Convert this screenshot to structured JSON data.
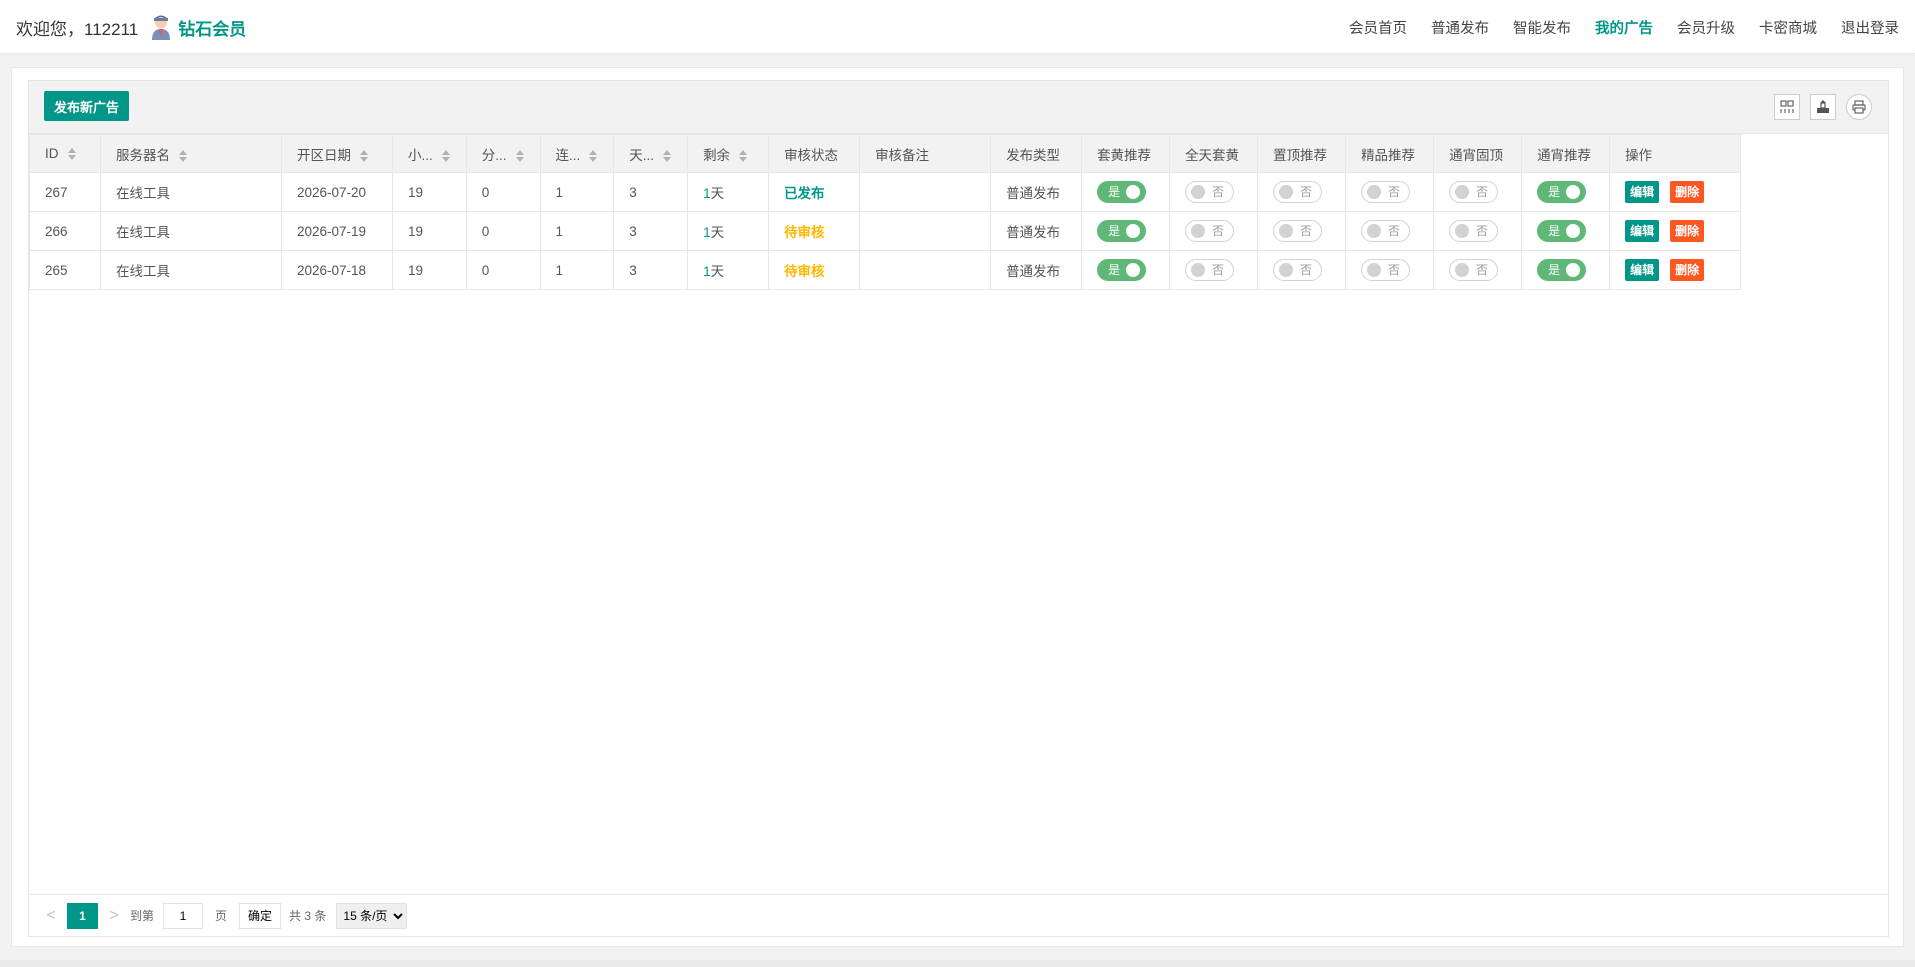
{
  "header": {
    "welcome": "欢迎您，112211",
    "level": "钻石会员",
    "nav": [
      {
        "label": "会员首页",
        "active": false
      },
      {
        "label": "普通发布",
        "active": false
      },
      {
        "label": "智能发布",
        "active": false
      },
      {
        "label": "我的广告",
        "active": true
      },
      {
        "label": "会员升级",
        "active": false
      },
      {
        "label": "卡密商城",
        "active": false
      },
      {
        "label": "退出登录",
        "active": false
      }
    ]
  },
  "toolbar": {
    "publish_label": "发布新广告",
    "icons": [
      "columns-filter-icon",
      "export-icon",
      "print-icon"
    ]
  },
  "table": {
    "columns": [
      "ID",
      "服务器名",
      "开区日期",
      "小...",
      "分...",
      "连...",
      "天...",
      "剩余",
      "审核状态",
      "审核备注",
      "发布类型",
      "套黄推荐",
      "全天套黄",
      "置顶推荐",
      "精品推荐",
      "通宵固顶",
      "通宵推荐",
      "操作"
    ],
    "rows": [
      {
        "id": "267",
        "name": "在线工具",
        "date": "2026-07-20",
        "c1": "19",
        "c2": "0",
        "c3": "1",
        "c4": "3",
        "remain_num": "1",
        "remain_unit": "天",
        "status": "已发布",
        "status_type": "published",
        "note": "",
        "type": "普通发布",
        "switches": [
          true,
          false,
          false,
          false,
          false,
          true
        ]
      },
      {
        "id": "266",
        "name": "在线工具",
        "date": "2026-07-19",
        "c1": "19",
        "c2": "0",
        "c3": "1",
        "c4": "3",
        "remain_num": "1",
        "remain_unit": "天",
        "status": "待审核",
        "status_type": "pending",
        "note": "",
        "type": "普通发布",
        "switches": [
          true,
          false,
          false,
          false,
          false,
          true
        ]
      },
      {
        "id": "265",
        "name": "在线工具",
        "date": "2026-07-18",
        "c1": "19",
        "c2": "0",
        "c3": "1",
        "c4": "3",
        "remain_num": "1",
        "remain_unit": "天",
        "status": "待审核",
        "status_type": "pending",
        "note": "",
        "type": "普通发布",
        "switches": [
          true,
          false,
          false,
          false,
          false,
          true
        ]
      }
    ],
    "switch_on_label": "是",
    "switch_off_label": "否",
    "edit_label": "编辑",
    "delete_label": "删除"
  },
  "pager": {
    "prev": "<",
    "current": "1",
    "next": ">",
    "goto_label": "到第",
    "page_input": "1",
    "page_unit": "页",
    "confirm_label": "确定",
    "total": "共 3 条",
    "page_size": "15 条/页"
  },
  "colors": {
    "accent": "#009688",
    "switch_on": "#5FB878",
    "danger": "#FF5722",
    "pending": "#FFB800"
  }
}
